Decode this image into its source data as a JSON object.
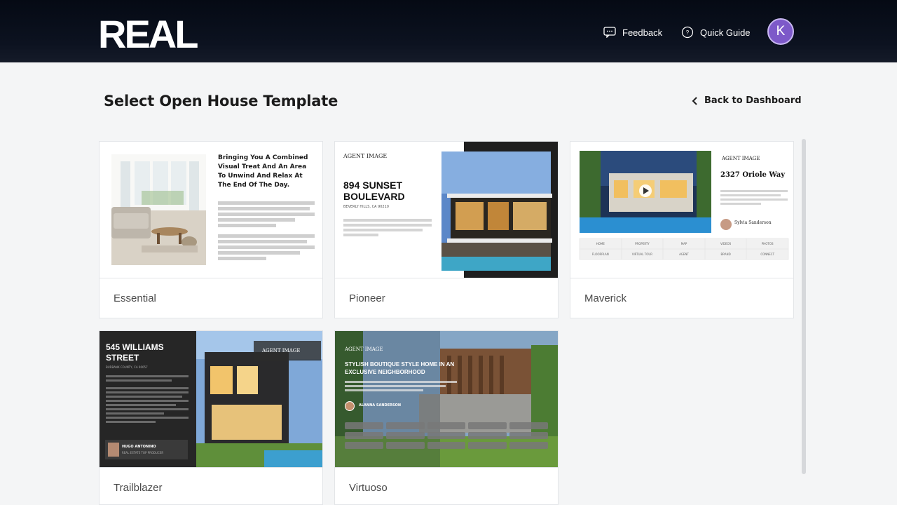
{
  "header": {
    "logo_text": "REAL",
    "feedback_label": "Feedback",
    "quick_guide_label": "Quick Guide",
    "avatar_initial": "K"
  },
  "page": {
    "title": "Select Open House Template",
    "back_label": "Back to Dashboard"
  },
  "templates": [
    {
      "name": "Essential",
      "heading": "Bringing You A Combined Visual Treat And An Area To Unwind And Relax At The End Of The Day."
    },
    {
      "name": "Pioneer",
      "brand": "AGENT IMAGE",
      "address": "894 SUNSET BOULEVARD",
      "location": "BEVERLY HILLS, CA 90210"
    },
    {
      "name": "Maverick",
      "brand": "AGENT IMAGE",
      "address": "2327 Oriole Way",
      "agent": "Sylvia Sanderson",
      "nav": [
        "HOME",
        "PROPERTY",
        "MAP",
        "VIDEOS",
        "PHOTOS",
        "FLOORPLAN",
        "VIRTUAL TOUR",
        "AGENT",
        "BRAND",
        "CONNECT"
      ]
    },
    {
      "name": "Trailblazer",
      "address": "545 WILLIAMS STREET",
      "location": "BURBANK COUNTY, CA 90057",
      "brand": "AGENT IMAGE",
      "agent": "HUGO ANTONINO",
      "agent_title": "REAL ESTATE TOP PRODUCER"
    },
    {
      "name": "Virtuoso",
      "brand": "AGENT IMAGE",
      "heading": "STYLISH BOUTIQUE STYLE HOME IN AN EXCLUSIVE NEIGHBORHOOD",
      "agent": "ALANNA SANDERSON"
    }
  ],
  "colors": {
    "header_bg": "#0c1220",
    "avatar_bg": "#7d59c9",
    "page_bg": "#f4f5f6"
  }
}
